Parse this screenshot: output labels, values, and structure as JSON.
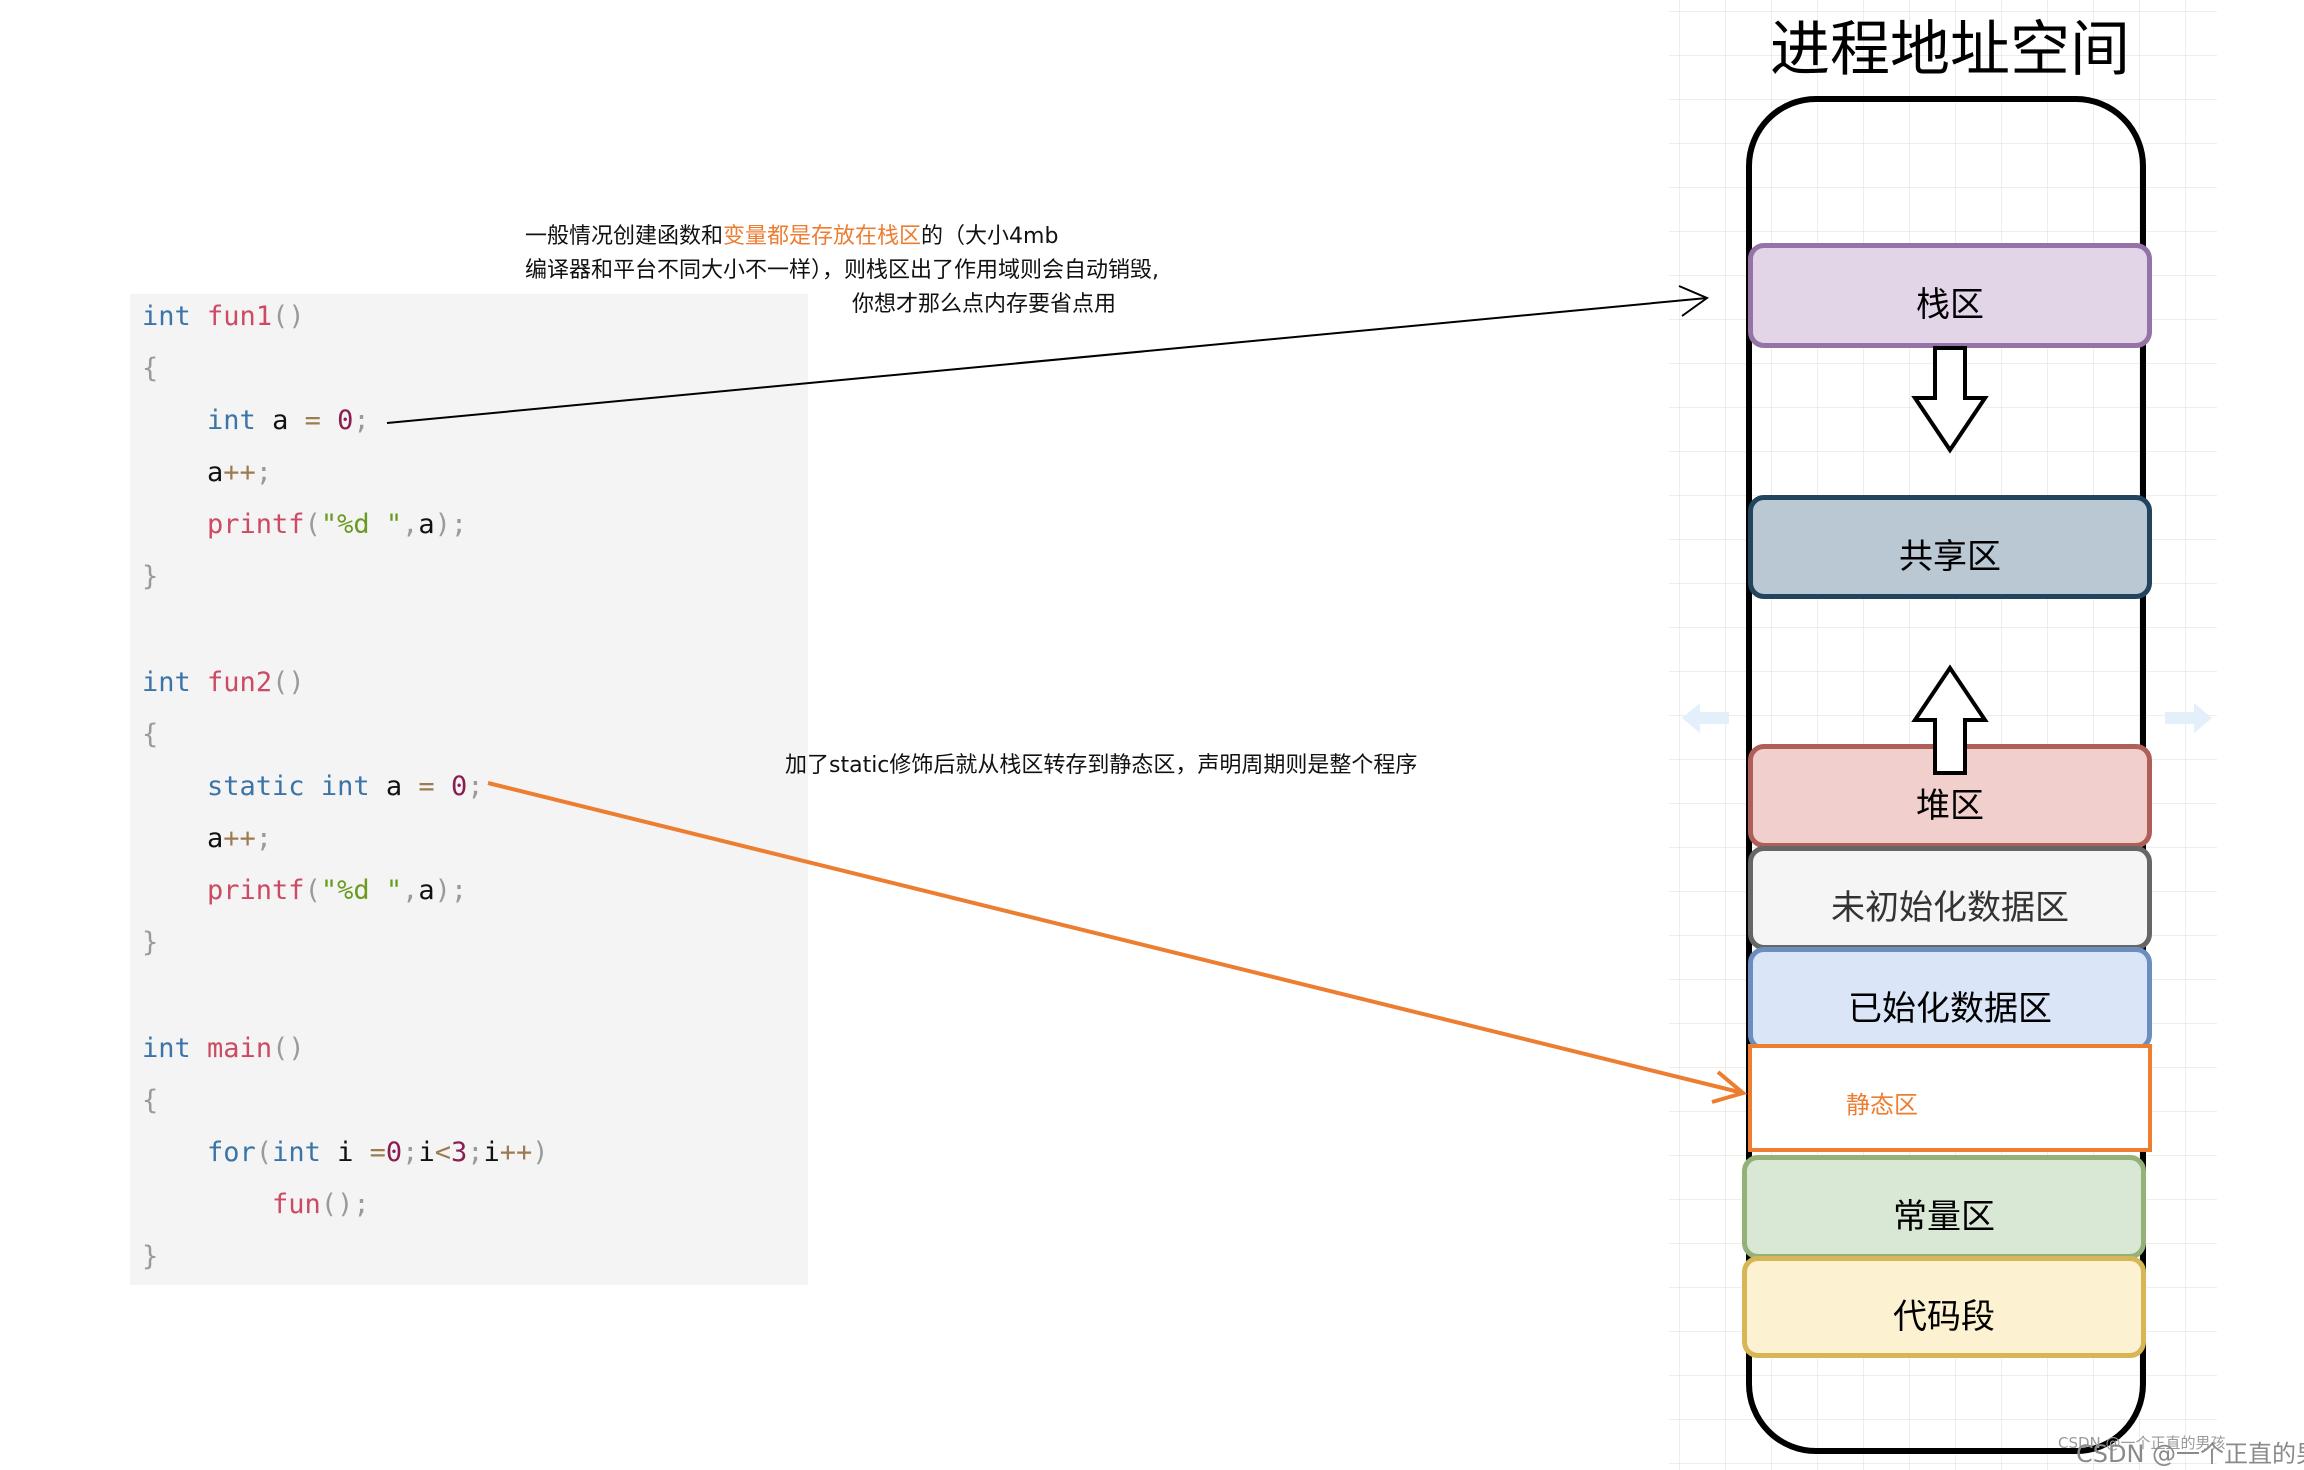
{
  "diagram": {
    "title": "进程地址空间",
    "segments": [
      {
        "id": "stack",
        "label": "栈区",
        "fill": "#e1d5e7",
        "stroke": "#9673a6"
      },
      {
        "id": "shared",
        "label": "共享区",
        "fill": "#bac8d3",
        "stroke": "#23445d"
      },
      {
        "id": "heap",
        "label": "堆区",
        "fill": "#f0cfcc",
        "stroke": "#ae6058"
      },
      {
        "id": "uninit",
        "label": "未初始化数据区",
        "fill": "#f5f5f5",
        "stroke": "#666666"
      },
      {
        "id": "init",
        "label": "已始化数据区",
        "fill": "#dae6f8",
        "stroke": "#6c8ebf"
      },
      {
        "id": "static",
        "label": "静态区",
        "fill": "#ffffff",
        "stroke": "#ed7d31"
      },
      {
        "id": "const",
        "label": "常量区",
        "fill": "#d9e7d5",
        "stroke": "#93b178"
      },
      {
        "id": "code",
        "label": "代码段",
        "fill": "#fcf2d1",
        "stroke": "#d6b656"
      }
    ],
    "growth_arrows": [
      {
        "from": "stack",
        "direction": "down"
      },
      {
        "from": "heap",
        "direction": "up"
      }
    ]
  },
  "annotations": {
    "stack_note": {
      "line1_prefix": "一般情况创建函数和",
      "line1_highlight": "变量都是存放在栈区",
      "line1_suffix": "的（大小4mb",
      "line2": "编译器和平台不同大小不一样），则栈区出了作用域则会自动销毁,",
      "line3": "你想才那么点内存要省点用"
    },
    "static_note": "加了static修饰后就从栈区转存到静态区，声明周期则是整个程序",
    "highlight_color": "#ed7d31",
    "connectors": [
      {
        "from": "int a = 0;",
        "to": "栈区",
        "color": "#000000"
      },
      {
        "from": "static int a = 0;",
        "to": "静态区",
        "color": "#ed7d31"
      }
    ]
  },
  "code": {
    "lines": [
      [
        [
          "kw",
          "int"
        ],
        [
          "id",
          " "
        ],
        [
          "fn",
          "fun1"
        ],
        [
          "pn",
          "()"
        ]
      ],
      [
        [
          "pn",
          "{"
        ]
      ],
      [
        [
          "id",
          "    "
        ],
        [
          "kw",
          "int"
        ],
        [
          "id",
          " a "
        ],
        [
          "op",
          "="
        ],
        [
          "id",
          " "
        ],
        [
          "num",
          "0"
        ],
        [
          "pn",
          ";"
        ]
      ],
      [
        [
          "id",
          "    a"
        ],
        [
          "op",
          "++"
        ],
        [
          "pn",
          ";"
        ]
      ],
      [
        [
          "id",
          "    "
        ],
        [
          "fn",
          "printf"
        ],
        [
          "pn",
          "("
        ],
        [
          "str",
          "\"%d \""
        ],
        [
          "pn",
          ","
        ],
        [
          "id",
          "a"
        ],
        [
          "pn",
          ");"
        ]
      ],
      [
        [
          "pn",
          "}"
        ]
      ],
      [],
      [
        [
          "kw",
          "int"
        ],
        [
          "id",
          " "
        ],
        [
          "fn",
          "fun2"
        ],
        [
          "pn",
          "()"
        ]
      ],
      [
        [
          "pn",
          "{"
        ]
      ],
      [
        [
          "id",
          "    "
        ],
        [
          "kw",
          "static"
        ],
        [
          "id",
          " "
        ],
        [
          "kw",
          "int"
        ],
        [
          "id",
          " a "
        ],
        [
          "op",
          "="
        ],
        [
          "id",
          " "
        ],
        [
          "num",
          "0"
        ],
        [
          "pn",
          ";"
        ]
      ],
      [
        [
          "id",
          "    a"
        ],
        [
          "op",
          "++"
        ],
        [
          "pn",
          ";"
        ]
      ],
      [
        [
          "id",
          "    "
        ],
        [
          "fn",
          "printf"
        ],
        [
          "pn",
          "("
        ],
        [
          "str",
          "\"%d \""
        ],
        [
          "pn",
          ","
        ],
        [
          "id",
          "a"
        ],
        [
          "pn",
          ");"
        ]
      ],
      [
        [
          "pn",
          "}"
        ]
      ],
      [],
      [
        [
          "kw",
          "int"
        ],
        [
          "id",
          " "
        ],
        [
          "fn",
          "main"
        ],
        [
          "pn",
          "()"
        ]
      ],
      [
        [
          "pn",
          "{"
        ]
      ],
      [
        [
          "id",
          "    "
        ],
        [
          "kw",
          "for"
        ],
        [
          "pn",
          "("
        ],
        [
          "kw",
          "int"
        ],
        [
          "id",
          " i "
        ],
        [
          "op",
          "="
        ],
        [
          "num",
          "0"
        ],
        [
          "pn",
          ";"
        ],
        [
          "id",
          "i"
        ],
        [
          "op",
          "<"
        ],
        [
          "num",
          "3"
        ],
        [
          "pn",
          ";"
        ],
        [
          "id",
          "i"
        ],
        [
          "op",
          "++"
        ],
        [
          "pn",
          ")"
        ]
      ],
      [
        [
          "id",
          "        "
        ],
        [
          "fn",
          "fun"
        ],
        [
          "pn",
          "();"
        ]
      ],
      [
        [
          "pn",
          "}"
        ]
      ]
    ]
  },
  "watermark": {
    "small": "CSDN @一个正直的男孩",
    "large": "CSDN @一个正直的男孩"
  }
}
